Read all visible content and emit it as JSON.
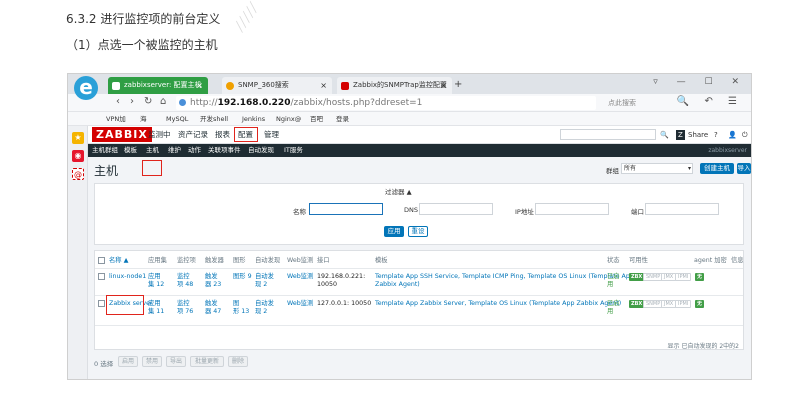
{
  "document": {
    "heading": "6.3.2 进行监控项的前台定义",
    "step": "（1）点选一个被监控的主机"
  },
  "browser": {
    "tabs": [
      {
        "label": "zabbixserver: 配置主机",
        "active": true
      },
      {
        "label": "SNMP_360搜索",
        "active": false
      },
      {
        "label": "Zabbix的SNMPTrap监控配置",
        "active": false
      }
    ],
    "url_prefix": "http://",
    "url_host": "192.168.0.220",
    "url_path": "/zabbix/hosts.php?ddreset=1",
    "search_placeholder": "点此搜索",
    "bookmarks": [
      "VPN加",
      "海",
      "MySQL",
      "开发shell",
      "Jenkins",
      "Nginx@",
      "百吧",
      "登录"
    ]
  },
  "colors": {
    "brand_red": "#d40000",
    "zabbix_blue": "#0275b8",
    "status_green": "#429e47",
    "dark_nav": "#1f2c33",
    "highlight_red": "#e0241c"
  },
  "zabbix": {
    "logo": "ZABBIX",
    "menu": [
      "监测中",
      "资产记录",
      "报表",
      "配置",
      "管理"
    ],
    "share": "Share",
    "submenu": [
      "主机群组",
      "模板",
      "主机",
      "维护",
      "动作",
      "关联项事件",
      "自动发现",
      "IT服务"
    ],
    "server_name": "zabbixserver",
    "page_title": "主机",
    "group_label": "群组",
    "group_value": "所有",
    "create_host": "创建主机",
    "import": "导入",
    "filter": {
      "title": "过滤器 ▲",
      "name_label": "名称",
      "dns_label": "DNS",
      "ip_label": "IP地址",
      "port_label": "端口",
      "apply": "应用",
      "reset": "重设"
    },
    "table": {
      "headers": [
        "名称 ▲",
        "应用集",
        "监控项",
        "触发器",
        "图形",
        "自动发现",
        "Web监测",
        "接口",
        "模板",
        "状态",
        "可用性",
        "agent 加密",
        "信息"
      ],
      "rows": [
        {
          "name": "linux-node1",
          "apps_a": "应用",
          "apps_b": "集 12",
          "items_a": "监控",
          "items_b": "项 48",
          "triggers_a": "触发",
          "triggers_b": "器 23",
          "graphs": "图形 9",
          "discovery_a": "自动发",
          "discovery_b": "现 2",
          "web": "Web监测",
          "interface_a": "192.168.0.221:",
          "interface_b": "10050",
          "templates_a": "Template App SSH Service, Template ICMP Ping, Template OS Linux (Template App",
          "templates_b": "Zabbix Agent)",
          "status_a": "已启",
          "status_b": "用",
          "zbx": "ZBX",
          "snmp": "SNMP",
          "jmx": "JMX",
          "ipmi": "IPMI",
          "encryption": "无"
        },
        {
          "name": "Zabbix server",
          "apps_a": "应用",
          "apps_b": "集 11",
          "items_a": "监控",
          "items_b": "项 76",
          "triggers_a": "触发",
          "triggers_b": "器 47",
          "graphs_a": "图",
          "graphs_b": "形 13",
          "discovery_a": "自动发",
          "discovery_b": "现 2",
          "web": "Web监测",
          "interface": "127.0.0.1: 10050",
          "templates": "Template App Zabbix Server, Template OS Linux (Template App Zabbix Agent)",
          "status_a": "已启",
          "status_b": "用",
          "zbx": "ZBX",
          "snmp": "SNMP",
          "jmx": "JMX",
          "ipmi": "IPMI",
          "encryption": "无"
        }
      ],
      "footer": "显示 已自动发现的 2中的2"
    },
    "mass": {
      "selected": "0 选择",
      "buttons": [
        "启用",
        "禁用",
        "导出",
        "批量更新",
        "删除"
      ]
    }
  }
}
